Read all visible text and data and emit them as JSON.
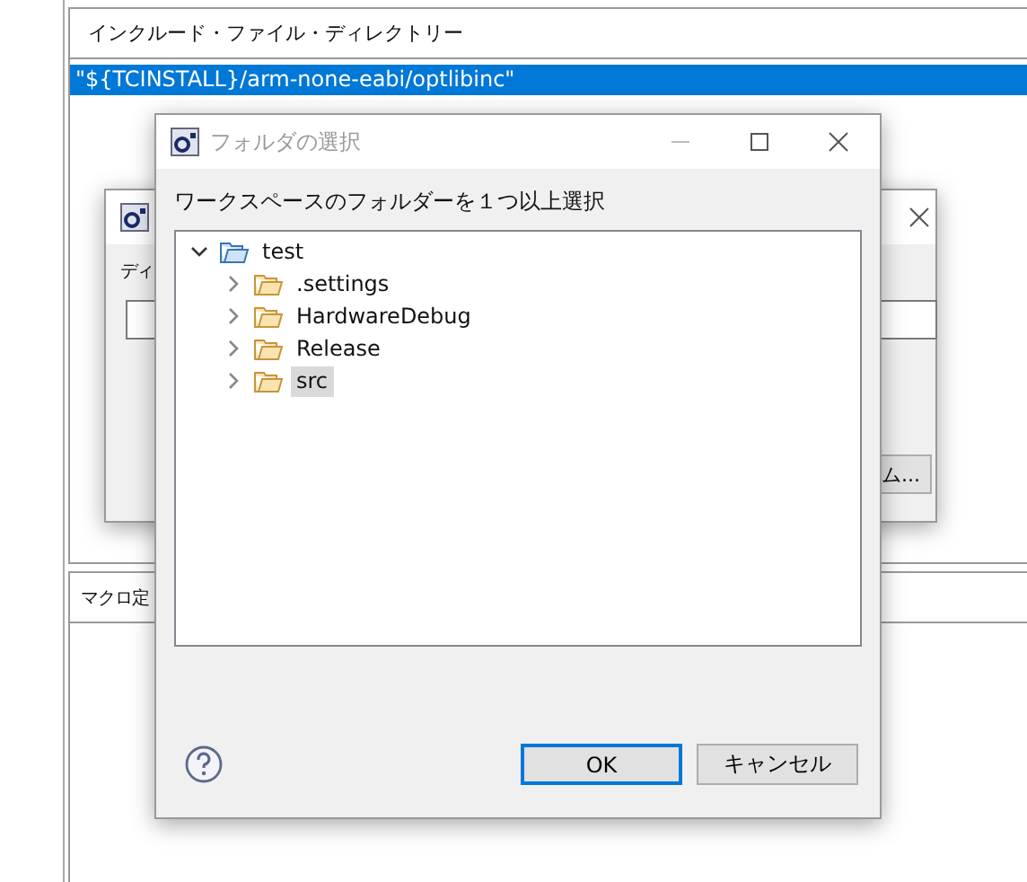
{
  "include_panel": {
    "header": "インクルード・ファイル・ディレクトリー",
    "rows": [
      {
        "text": "\"${TCINSTALL}/arm-none-eabi/optlibinc\"",
        "selected": true
      }
    ]
  },
  "macro_panel": {
    "header": "マクロ定"
  },
  "back_dialog": {
    "label": "ディ",
    "button": "ム..."
  },
  "dialog": {
    "title": "フォルダの選択",
    "prompt": "ワークスペースのフォルダーを１つ以上選択",
    "tree": [
      {
        "label": "test",
        "kind": "project",
        "expanded": true,
        "selected": false,
        "children": [
          {
            "label": ".settings",
            "kind": "folder",
            "expanded": false,
            "selected": false
          },
          {
            "label": "HardwareDebug",
            "kind": "folder",
            "expanded": false,
            "selected": false
          },
          {
            "label": "Release",
            "kind": "folder",
            "expanded": false,
            "selected": false
          },
          {
            "label": "src",
            "kind": "folder",
            "expanded": false,
            "selected": true
          }
        ]
      }
    ],
    "buttons": [
      {
        "label": "OK",
        "default": true
      },
      {
        "label": "キャンセル",
        "default": false
      }
    ]
  }
}
